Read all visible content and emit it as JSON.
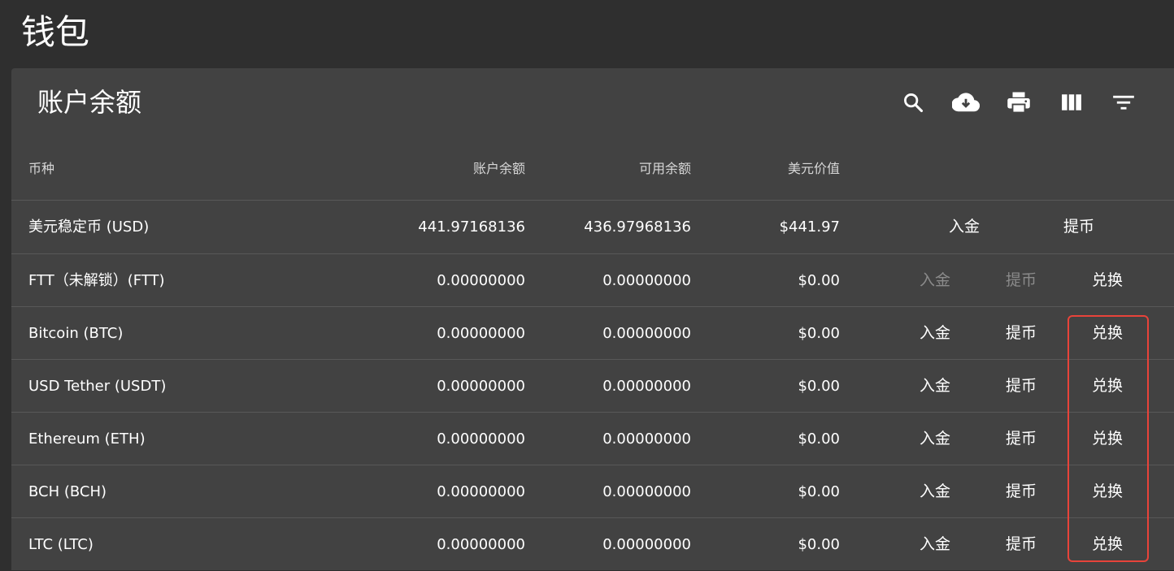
{
  "page": {
    "title": "钱包"
  },
  "card": {
    "title": "账户余额"
  },
  "toolbar": {
    "icons": [
      "search-icon",
      "download-icon",
      "print-icon",
      "view-columns-icon",
      "filter-icon"
    ]
  },
  "columns": {
    "coin": "币种",
    "balance": "账户余额",
    "available": "可用余额",
    "usd_value": "美元价值"
  },
  "rows": [
    {
      "name": "美元稳定币 (USD)",
      "balance": "441.97168136",
      "available": "436.97968136",
      "usd": "$441.97",
      "actions": {
        "deposit": "入金",
        "withdraw": "提币"
      }
    },
    {
      "name": "FTT（未解锁）(FTT)",
      "balance": "0.00000000",
      "available": "0.00000000",
      "usd": "$0.00",
      "actions": {
        "deposit": "入金",
        "withdraw": "提币",
        "convert": "兑换"
      }
    },
    {
      "name": "Bitcoin (BTC)",
      "balance": "0.00000000",
      "available": "0.00000000",
      "usd": "$0.00",
      "actions": {
        "deposit": "入金",
        "withdraw": "提币",
        "convert": "兑换"
      }
    },
    {
      "name": "USD Tether (USDT)",
      "balance": "0.00000000",
      "available": "0.00000000",
      "usd": "$0.00",
      "actions": {
        "deposit": "入金",
        "withdraw": "提币",
        "convert": "兑换"
      }
    },
    {
      "name": "Ethereum (ETH)",
      "balance": "0.00000000",
      "available": "0.00000000",
      "usd": "$0.00",
      "actions": {
        "deposit": "入金",
        "withdraw": "提币",
        "convert": "兑换"
      }
    },
    {
      "name": "BCH (BCH)",
      "balance": "0.00000000",
      "available": "0.00000000",
      "usd": "$0.00",
      "actions": {
        "deposit": "入金",
        "withdraw": "提币",
        "convert": "兑换"
      }
    },
    {
      "name": "LTC (LTC)",
      "balance": "0.00000000",
      "available": "0.00000000",
      "usd": "$0.00",
      "actions": {
        "deposit": "入金",
        "withdraw": "提币",
        "convert": "兑换"
      }
    }
  ],
  "colors": {
    "background": "#2f2f2f",
    "card": "#424242",
    "divider": "#585858",
    "disabled": "#8a8a8a",
    "highlight": "#e8433a"
  }
}
